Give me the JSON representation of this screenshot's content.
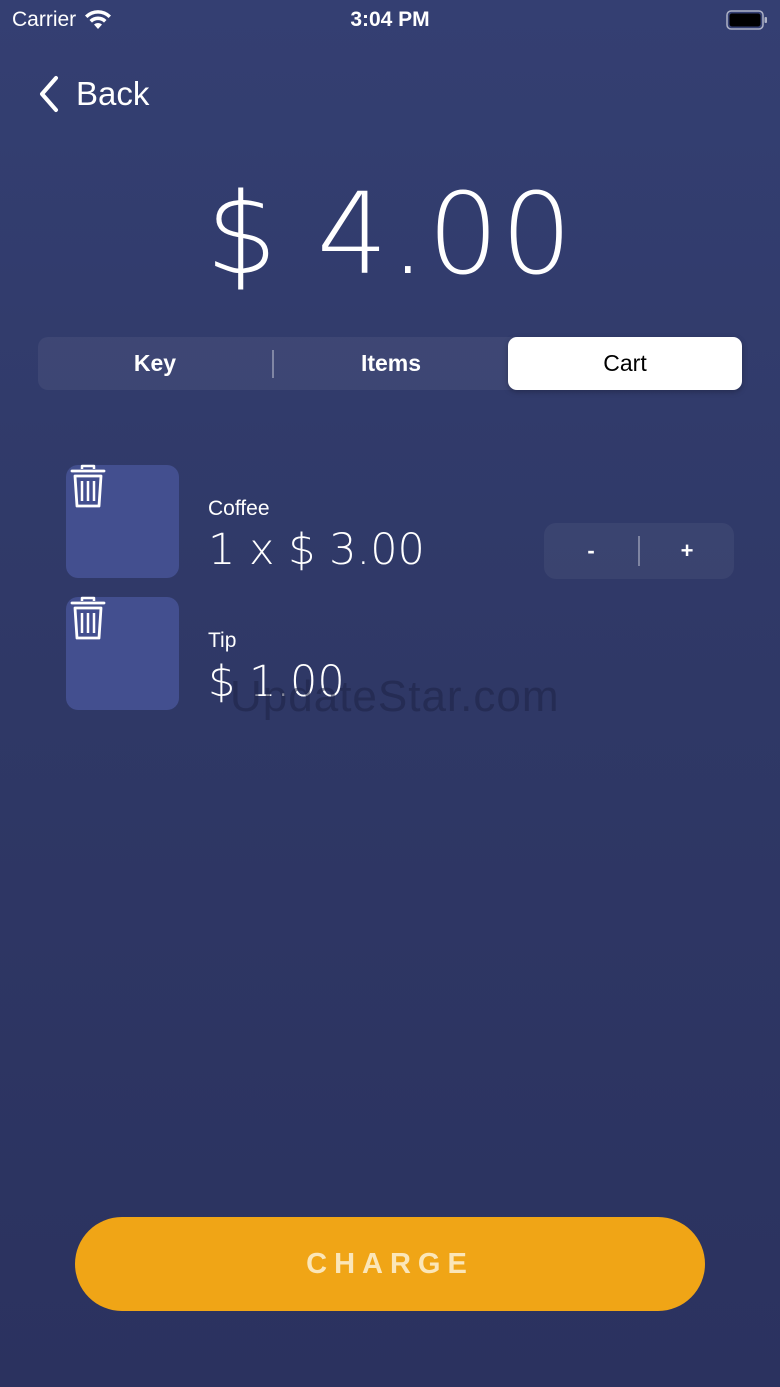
{
  "status_bar": {
    "carrier": "Carrier",
    "time": "3:04 PM",
    "wifi_icon": "wifi-icon",
    "battery_icon": "battery-icon"
  },
  "nav": {
    "back_label": "Back",
    "back_icon": "chevron-left-icon"
  },
  "total": {
    "amount": "$ 4.00"
  },
  "tabs": [
    {
      "label": "Key",
      "active": false
    },
    {
      "label": "Items",
      "active": false
    },
    {
      "label": "Cart",
      "active": true
    }
  ],
  "cart": {
    "items": [
      {
        "name": "Coffee",
        "price": "1 x $ 3.00",
        "has_stepper": true
      },
      {
        "name": "Tip",
        "price": "$ 1.00",
        "has_stepper": false
      }
    ],
    "stepper": {
      "minus": "-",
      "plus": "+"
    },
    "delete_icon": "trash-icon"
  },
  "watermark": "UpdateStar.com",
  "charge_label": "CHARGE",
  "colors": {
    "background": "#2f3866",
    "thumb": "#434f8f",
    "accent": "#f0a516"
  }
}
